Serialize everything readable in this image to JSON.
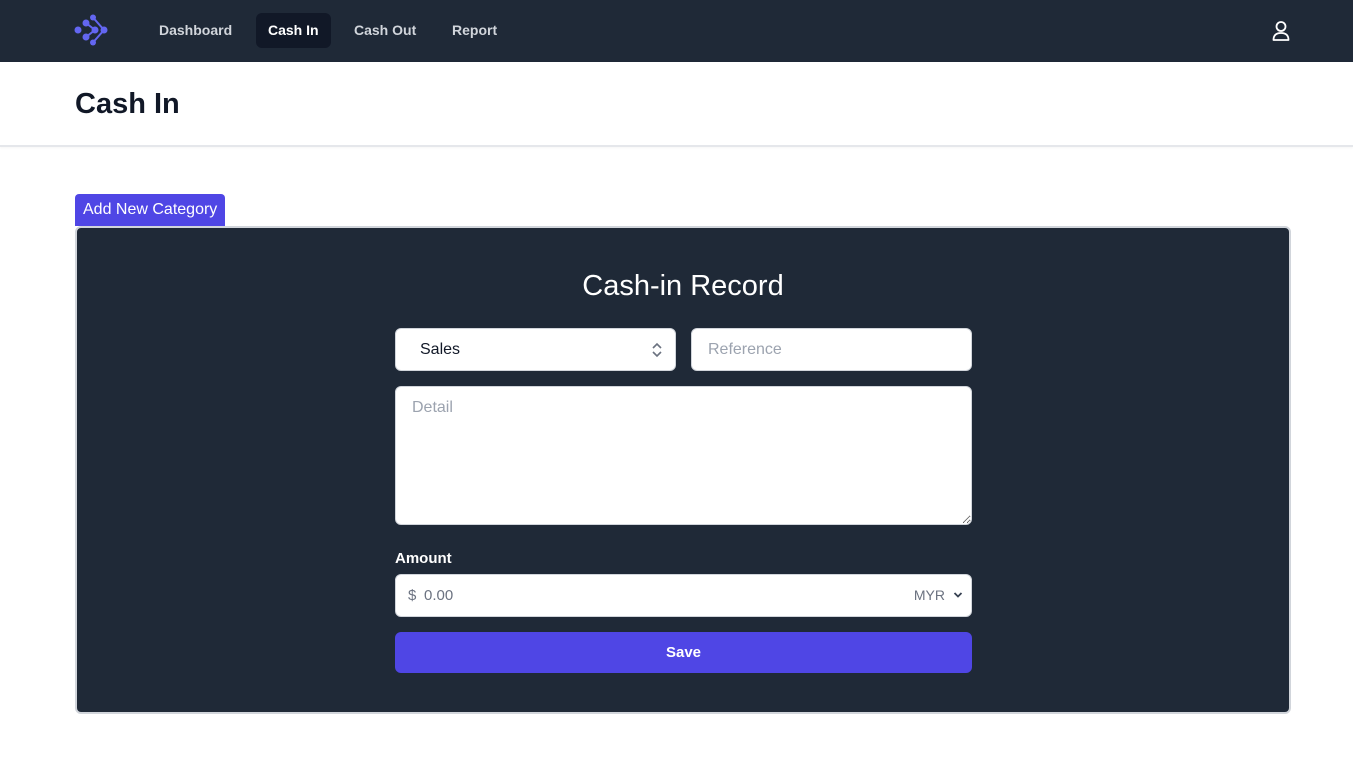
{
  "nav": {
    "items": [
      {
        "label": "Dashboard"
      },
      {
        "label": "Cash In"
      },
      {
        "label": "Cash Out"
      },
      {
        "label": "Report"
      }
    ],
    "active": "Cash In"
  },
  "header": {
    "title": "Cash In"
  },
  "add_category": {
    "label": "Add New Category"
  },
  "form": {
    "title": "Cash-in Record",
    "category_selected": "Sales",
    "reference_placeholder": "Reference",
    "detail_placeholder": "Detail",
    "amount_label": "Amount",
    "currency_symbol": "$",
    "amount_placeholder": "0.00",
    "currency_selected": "MYR",
    "save_label": "Save"
  },
  "colors": {
    "navbar_bg": "#1f2937",
    "accent": "#4f46e5",
    "card_bg": "#1f2937"
  },
  "icons": {
    "logo": "logo-icon",
    "user": "user-icon"
  }
}
